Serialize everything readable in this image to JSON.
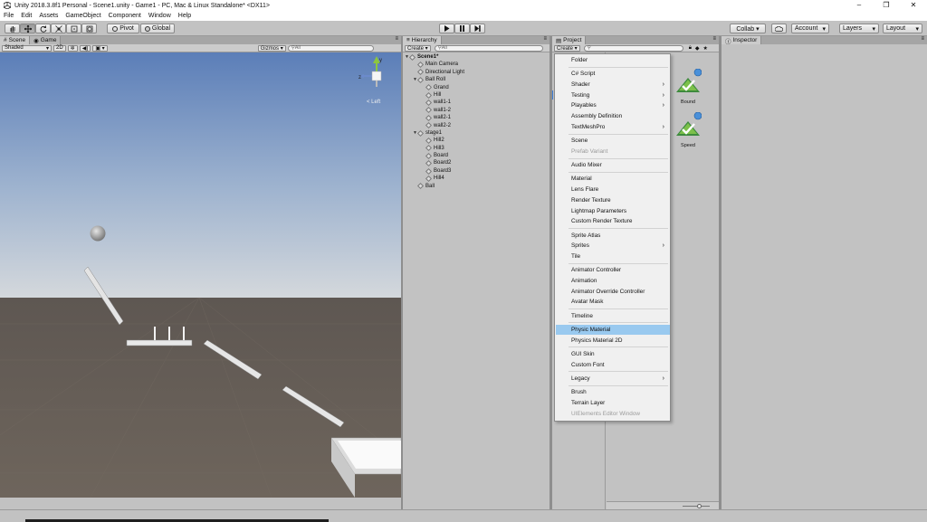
{
  "window": {
    "title": "Unity 2018.3.8f1 Personal - Scene1.unity - Game1 - PC, Mac & Linux Standalone* <DX11>",
    "controls": [
      "–",
      "❐",
      "✕"
    ]
  },
  "menubar": [
    "File",
    "Edit",
    "Assets",
    "GameObject",
    "Component",
    "Window",
    "Help"
  ],
  "toolbar": {
    "pivot": "Pivot",
    "global": "Global",
    "collab": "Collab ▾",
    "account": "Account",
    "layers": "Layers",
    "layout": "Layout"
  },
  "scene": {
    "tabs": [
      "Scene",
      "Game"
    ],
    "shading": "Shaded",
    "mode2d": "2D",
    "gizmos": "Gizmos ▾",
    "search": "All",
    "gizmo_label": "< Left"
  },
  "hierarchy": {
    "tab": "Hierarchy",
    "create": "Create ▾",
    "search": "All",
    "items": [
      {
        "label": "Scene1*",
        "level": 0,
        "fold": "▼",
        "scene": true
      },
      {
        "label": "Main Camera",
        "level": 1,
        "fold": ""
      },
      {
        "label": "Directional Light",
        "level": 1,
        "fold": ""
      },
      {
        "label": "Ball Roll",
        "level": 1,
        "fold": "▼"
      },
      {
        "label": "Grand",
        "level": 2,
        "fold": ""
      },
      {
        "label": "Hill",
        "level": 2,
        "fold": ""
      },
      {
        "label": "wall1-1",
        "level": 2,
        "fold": ""
      },
      {
        "label": "wall1-2",
        "level": 2,
        "fold": ""
      },
      {
        "label": "wall2-1",
        "level": 2,
        "fold": ""
      },
      {
        "label": "wall2-2",
        "level": 2,
        "fold": ""
      },
      {
        "label": "stage1",
        "level": 1,
        "fold": "▼"
      },
      {
        "label": "Hill2",
        "level": 2,
        "fold": ""
      },
      {
        "label": "Hill3",
        "level": 2,
        "fold": ""
      },
      {
        "label": "Board",
        "level": 2,
        "fold": ""
      },
      {
        "label": "Board2",
        "level": 2,
        "fold": ""
      },
      {
        "label": "Board3",
        "level": 2,
        "fold": ""
      },
      {
        "label": "Hill4",
        "level": 2,
        "fold": ""
      },
      {
        "label": "Ball",
        "level": 1,
        "fold": ""
      }
    ]
  },
  "project": {
    "tab": "Project",
    "create": "Create ▾",
    "assets": [
      "Bound",
      "Speed"
    ]
  },
  "inspector": {
    "tab": "Inspector"
  },
  "context_menu": {
    "highlight_color": "#99c9ef",
    "items": [
      {
        "label": "Folder",
        "sep_after": true
      },
      {
        "label": "C# Script"
      },
      {
        "label": "Shader",
        "submenu": true
      },
      {
        "label": "Testing",
        "submenu": true
      },
      {
        "label": "Playables",
        "submenu": true
      },
      {
        "label": "Assembly Definition"
      },
      {
        "label": "TextMeshPro",
        "submenu": true,
        "sep_after": true
      },
      {
        "label": "Scene"
      },
      {
        "label": "Prefab Variant",
        "disabled": true,
        "sep_after": true
      },
      {
        "label": "Audio Mixer",
        "sep_after": true
      },
      {
        "label": "Material"
      },
      {
        "label": "Lens Flare"
      },
      {
        "label": "Render Texture"
      },
      {
        "label": "Lightmap Parameters"
      },
      {
        "label": "Custom Render Texture",
        "sep_after": true
      },
      {
        "label": "Sprite Atlas"
      },
      {
        "label": "Sprites",
        "submenu": true
      },
      {
        "label": "Tile",
        "sep_after": true
      },
      {
        "label": "Animator Controller"
      },
      {
        "label": "Animation"
      },
      {
        "label": "Animator Override Controller"
      },
      {
        "label": "Avatar Mask",
        "sep_after": true
      },
      {
        "label": "Timeline",
        "sep_after": true
      },
      {
        "label": "Physic Material",
        "highlighted": true
      },
      {
        "label": "Physics Material 2D",
        "sep_after": true
      },
      {
        "label": "GUI Skin"
      },
      {
        "label": "Custom Font",
        "sep_after": true
      },
      {
        "label": "Legacy",
        "submenu": true,
        "sep_after": true
      },
      {
        "label": "Brush"
      },
      {
        "label": "Terrain Layer"
      },
      {
        "label": "UIElements Editor Window",
        "disabled": true
      }
    ]
  }
}
